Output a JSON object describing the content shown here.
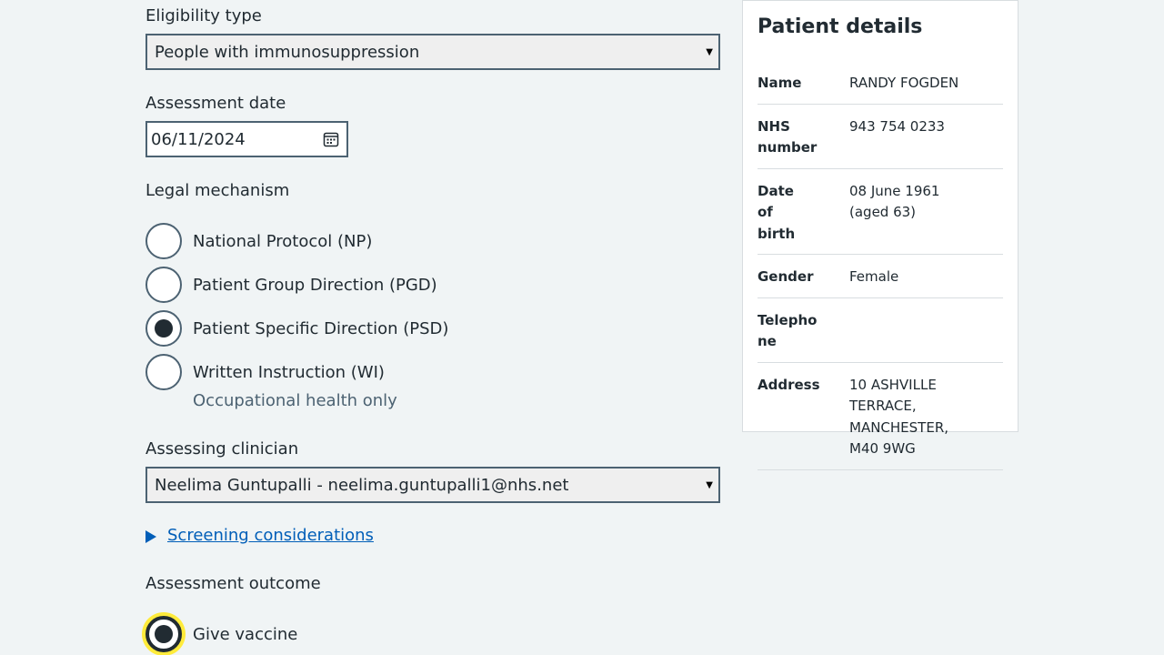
{
  "form": {
    "eligibility": {
      "label": "Eligibility type",
      "value": "People with immunosuppression"
    },
    "assessment_date": {
      "label": "Assessment date",
      "value": "06/11/2024"
    },
    "legal_mechanism": {
      "label": "Legal mechanism",
      "options": [
        {
          "label": "National Protocol (NP)",
          "selected": false
        },
        {
          "label": "Patient Group Direction (PGD)",
          "selected": false
        },
        {
          "label": "Patient Specific Direction (PSD)",
          "selected": true
        },
        {
          "label": "Written Instruction (WI)",
          "selected": false,
          "hint": "Occupational health only"
        }
      ]
    },
    "assessing_clinician": {
      "label": "Assessing clinician",
      "value": "Neelima Guntupalli - neelima.guntupalli1@nhs.net"
    },
    "screening": {
      "label": "Screening considerations"
    },
    "assessment_outcome": {
      "label": "Assessment outcome",
      "options": [
        {
          "label": "Give vaccine",
          "selected": true
        }
      ]
    }
  },
  "patient": {
    "title": "Patient details",
    "rows": [
      {
        "key": "Name",
        "value": "RANDY FOGDEN"
      },
      {
        "key": "NHS number",
        "value": "943 754 0233"
      },
      {
        "key": "Date of birth",
        "value": "08 June 1961 (aged 63)"
      },
      {
        "key": "Gender",
        "value": "Female"
      },
      {
        "key": "Telephone",
        "value": ""
      },
      {
        "key": "Address",
        "value": "10 ASHVILLE TERRACE, MANCHESTER, M40 9WG"
      }
    ]
  }
}
